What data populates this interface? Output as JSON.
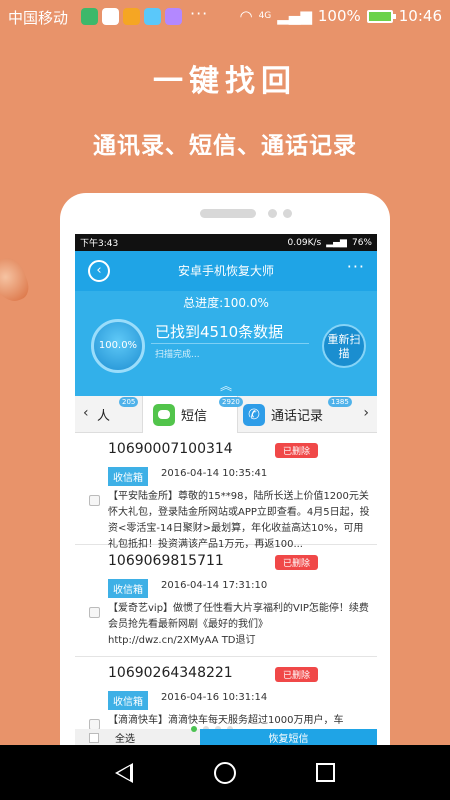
{
  "status_bar": {
    "carrier": "中国移动",
    "more": "···",
    "network": "4G",
    "battery": "100%",
    "time": "10:46"
  },
  "promo": {
    "headline": "一键找回",
    "subheadline": "通讯录、短信、通话记录"
  },
  "inner_status": {
    "time": "下午3:43",
    "speed": "0.09K/s",
    "battery": "76%"
  },
  "app": {
    "title": "安卓手机恢复大师",
    "back_icon": "‹",
    "menu": "···"
  },
  "progress": {
    "total_label": "总进度:100.0%",
    "percent": "100.0%",
    "found": "已找到4510条数据",
    "scan_status": "扫描完成...",
    "rescan": "重新扫描",
    "expand_icon": "︽"
  },
  "tabs": {
    "prev": "‹",
    "next": "›",
    "contacts": {
      "label": "人",
      "count": "205"
    },
    "sms": {
      "label": "短信",
      "count": "2920"
    },
    "calls": {
      "label": "通话记录",
      "count": "1385"
    }
  },
  "messages": [
    {
      "number": "10690007100314",
      "badge": "已删除",
      "folder": "收信箱",
      "time": "2016-04-14 10:35:41",
      "body": "【平安陆金所】尊敬的15**98，陆所长送上价值1200元关怀大礼包，登录陆金所网站或APP立即查看。4月5日起，投资<零活宝-14日聚财>最划算，年化收益高达10%，可用礼包抵扣！投资满该产品1万元，再返100..."
    },
    {
      "number": "1069069815711",
      "badge": "已删除",
      "folder": "收信箱",
      "time": "2016-04-14 17:31:10",
      "body": "【爱奇艺vip】做惯了任性看大片享福利的VIP怎能停！续费会员抢先看最新网剧《最好的我们》http://dwz.cn/2XMyAA TD退订"
    },
    {
      "number": "10690264348221",
      "badge": "已删除",
      "folder": "收信箱",
      "time": "2016-04-16 10:31:14",
      "body": "【滴滴快车】滴滴快车每天服务超过1000万用户，车"
    }
  ],
  "bottom": {
    "select_all": "全选",
    "restore": "恢复短信"
  }
}
